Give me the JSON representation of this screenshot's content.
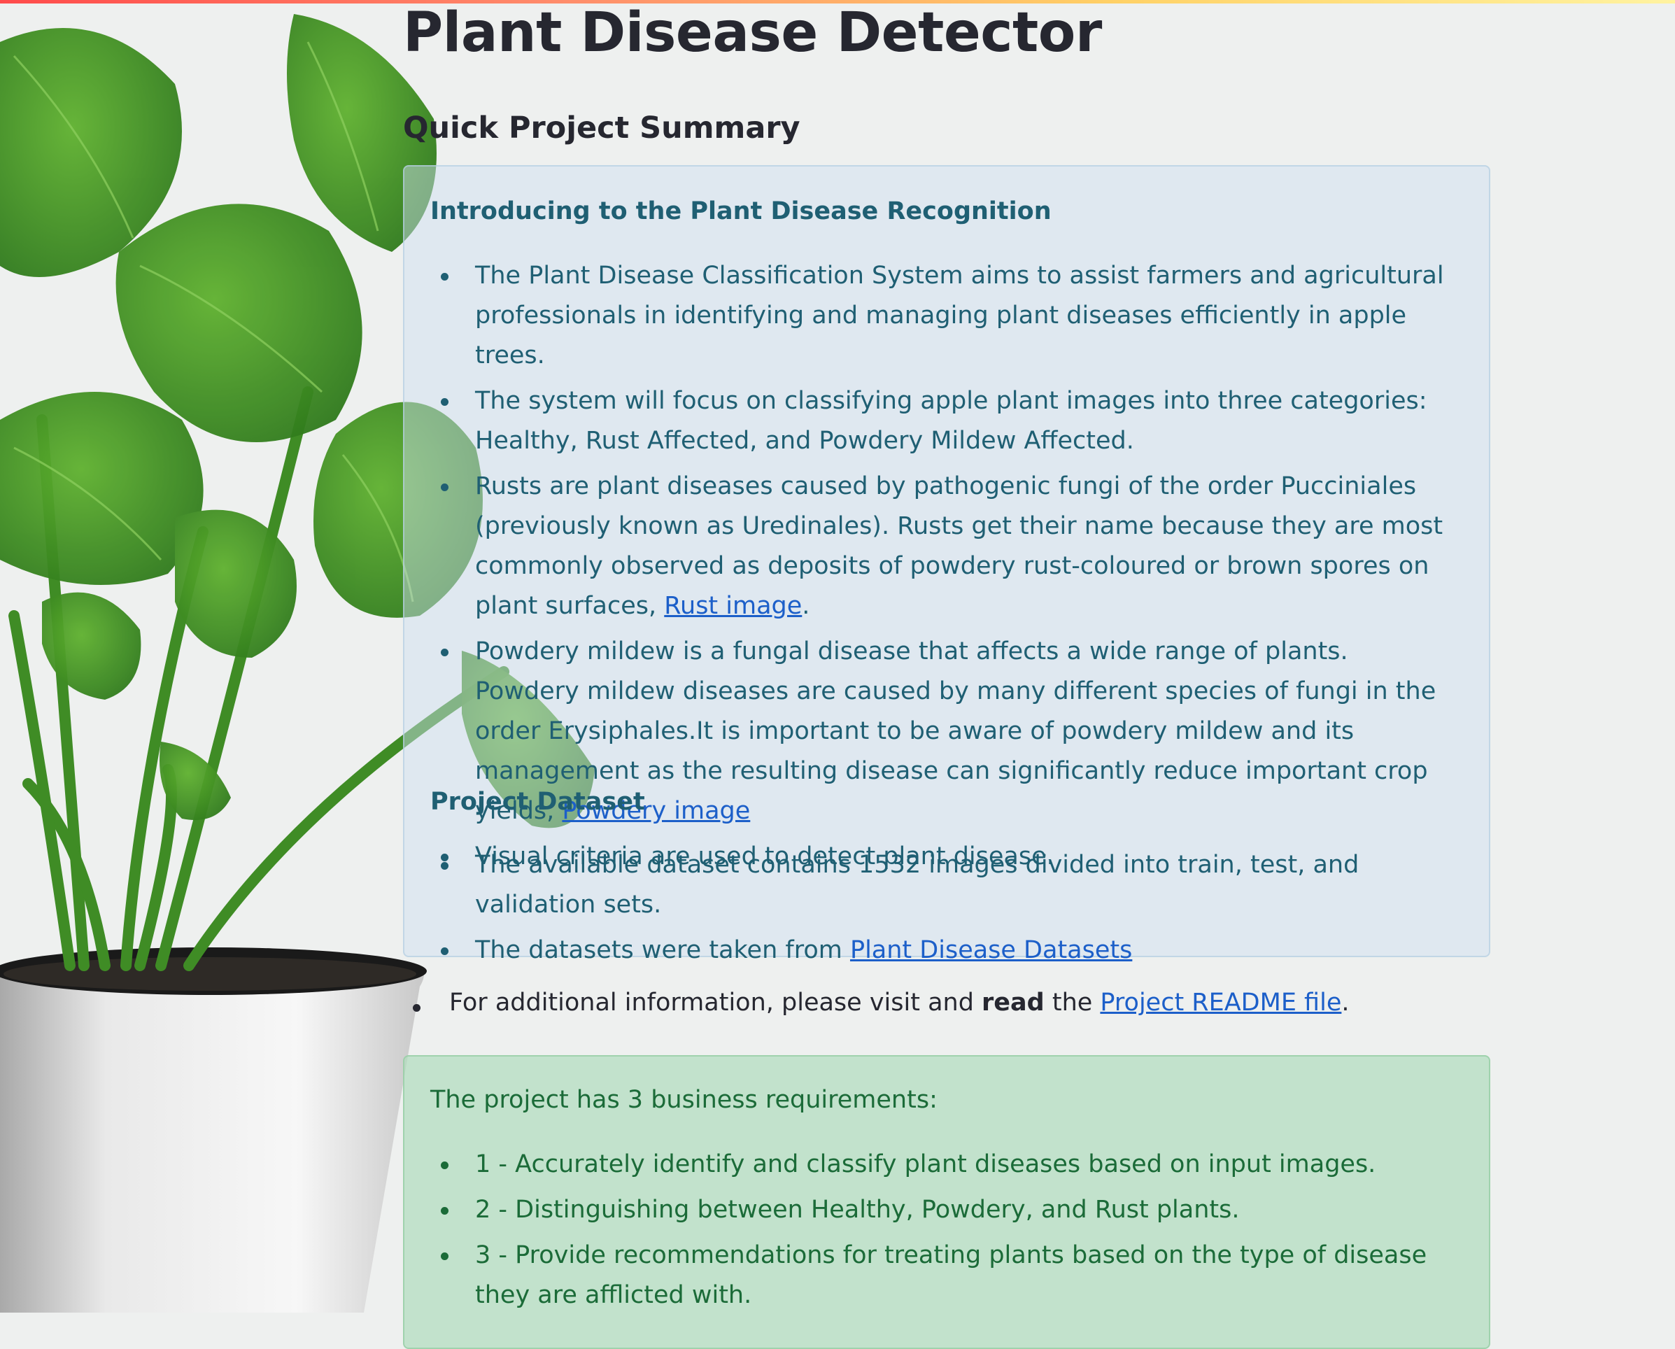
{
  "page": {
    "title": "Plant Disease Detector",
    "subtitle": "Quick Project Summary"
  },
  "info_box": {
    "heading_intro": "Introducing to the Plant Disease Recognition",
    "bullets": [
      "The Plant Disease Classification System aims to assist farmers and agricultural professionals in identifying and managing plant diseases efficiently in apple trees.",
      "The system will focus on classifying apple plant images into three categories: Healthy, Rust Affected, and Powdery Mildew Affected.",
      "Rusts are plant diseases caused by pathogenic fungi of the order Pucciniales (previously known as Uredinales). Rusts get their name because they are most commonly observed as deposits of powdery rust-coloured or brown spores on plant surfaces, ",
      "Powdery mildew is a fungal disease that affects a wide range of plants. Powdery mildew diseases are caused by many different species of fungi in the order Erysiphales.It is important to be aware of powdery mildew and its management as the resulting disease can significantly reduce important crop yields, ",
      "Visual criteria are used to detect plant disease."
    ],
    "rust_link": "Rust image",
    "rust_after": ".",
    "powdery_link": "Powdery image",
    "heading_dataset": "Project Dataset",
    "dataset_bullet_1": "The available dataset contains 1532 images divided into train, test, and validation sets.",
    "dataset_bullet_2_prefix": "The datasets were taken from ",
    "dataset_link": "Plant Disease Datasets"
  },
  "readme": {
    "prefix": "For additional information, please visit and ",
    "bold": "read",
    "middle": " the ",
    "link": "Project README file",
    "suffix": "."
  },
  "success_box": {
    "intro": "The project has 3 business requirements:",
    "requirements": [
      "1 - Accurately identify and classify plant diseases based on input images.",
      "2 - Distinguishing between Healthy, Powdery, and Rust plants.",
      "3 - Provide recommendations for treating plants based on the type of disease they are afflicted with."
    ]
  },
  "colors": {
    "accent_gradient": [
      "#ff4b4b",
      "#ffd166"
    ],
    "info_text": "#1f5f73",
    "success_text": "#1b6b38",
    "link": "#1c5fc9"
  }
}
